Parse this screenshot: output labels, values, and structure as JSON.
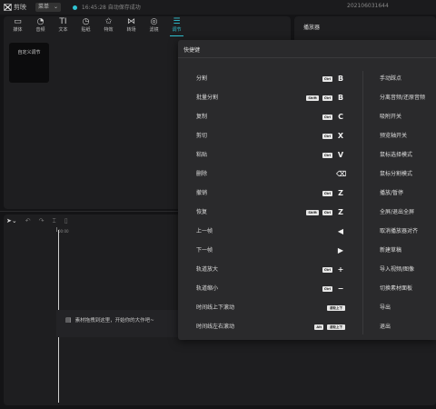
{
  "titlebar": {
    "app_name": "剪映",
    "menu_label": "菜单",
    "save_status": "16:45:28 自动保存成功",
    "project_name": "202106031644"
  },
  "tools": [
    {
      "label": "媒体",
      "icon": "media-icon",
      "glyph": "▭"
    },
    {
      "label": "音频",
      "icon": "audio-icon",
      "glyph": "◔"
    },
    {
      "label": "文本",
      "icon": "text-icon",
      "glyph": "TI"
    },
    {
      "label": "贴纸",
      "icon": "sticker-icon",
      "glyph": "◷"
    },
    {
      "label": "特效",
      "icon": "effects-icon",
      "glyph": "✩"
    },
    {
      "label": "转场",
      "icon": "transition-icon",
      "glyph": "⋈"
    },
    {
      "label": "滤镜",
      "icon": "filter-icon",
      "glyph": "◎"
    },
    {
      "label": "调节",
      "icon": "adjust-icon",
      "glyph": "☰"
    }
  ],
  "active_tool": "调节",
  "adjust_panel": {
    "custom_card": "自定义调节"
  },
  "player": {
    "title": "播放器"
  },
  "timeline": {
    "ruler_start": "00:00",
    "hint": "素材拖拽到这里，开始你的大作吧~"
  },
  "shortcut_dialog": {
    "title": "快捷键",
    "left": [
      {
        "label": "分割",
        "mods": [
          "Ctrl"
        ],
        "key": "B"
      },
      {
        "label": "批量分割",
        "mods": [
          "Shift",
          "Ctrl"
        ],
        "key": "B"
      },
      {
        "label": "复制",
        "mods": [
          "Ctrl"
        ],
        "key": "C"
      },
      {
        "label": "剪切",
        "mods": [
          "Ctrl"
        ],
        "key": "X"
      },
      {
        "label": "粘贴",
        "mods": [
          "Ctrl"
        ],
        "key": "V"
      },
      {
        "label": "删除",
        "mods": [],
        "key": "⌫"
      },
      {
        "label": "撤销",
        "mods": [
          "Ctrl"
        ],
        "key": "Z"
      },
      {
        "label": "恢复",
        "mods": [
          "Shift",
          "Ctrl"
        ],
        "key": "Z"
      },
      {
        "label": "上一帧",
        "mods": [],
        "key": "◀"
      },
      {
        "label": "下一帧",
        "mods": [],
        "key": "▶"
      },
      {
        "label": "轨道放大",
        "mods": [
          "Ctrl"
        ],
        "key": "+"
      },
      {
        "label": "轨道缩小",
        "mods": [
          "Ctrl"
        ],
        "key": "−"
      },
      {
        "label": "时间线上下滚动",
        "mods": [],
        "key": "",
        "pill": "滚轮上下"
      },
      {
        "label": "时间线左右滚动",
        "mods": [
          "Alt"
        ],
        "key": "",
        "pill": "滚轮上下"
      }
    ],
    "right": [
      "手动踩点",
      "分离音频/还原音频",
      "吸附开关",
      "预览轴开关",
      "鼠标选择模式",
      "鼠标分割模式",
      "播放/暂停",
      "全屏/退出全屏",
      "取消播放器对齐",
      "新建草稿",
      "导入视频/图像",
      "切换素材面板",
      "导出",
      "退出"
    ]
  }
}
